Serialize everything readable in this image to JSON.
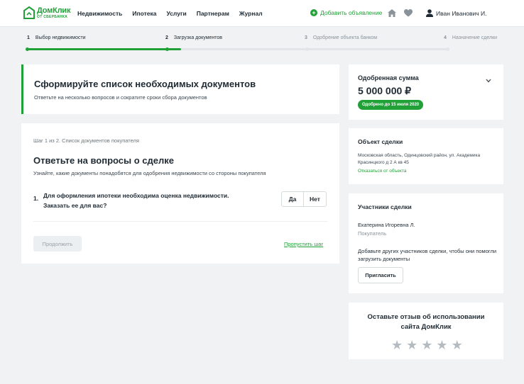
{
  "header": {
    "logo_main": "ДомКлик",
    "logo_sub": "ОТ СБЕРБАНКА",
    "nav": [
      "Недвижимость",
      "Ипотека",
      "Услуги",
      "Партнерам",
      "Журнал"
    ],
    "add_ad": "Добавить объявление",
    "user_name": "Иван Иванович И."
  },
  "steps": [
    {
      "num": "1",
      "label": "Выбор недвижимости"
    },
    {
      "num": "2",
      "label": "Загрузка документов"
    },
    {
      "num": "3",
      "label": "Одобрение объекта банком"
    },
    {
      "num": "4",
      "label": "Назначение сделки"
    }
  ],
  "progress": {
    "completed_steps": 2,
    "current_step_fraction": 0.1
  },
  "intro": {
    "title": "Сформируйте список необходимых документов",
    "subtitle": "Ответьте на несколько вопросов и сократите сроки сбора документов"
  },
  "questionnaire": {
    "step_label": "Шаг 1 из 2. Список документов покупателя",
    "title": "Ответьте на вопросы о сделке",
    "subtitle": "Узнайте, какие документы понадобятся для одобрения недвижимости со стороны покупателя",
    "question_num": "1.",
    "question_line1": "Для оформления ипотеки необходима оценка недвижимости.",
    "question_line2": "Заказать ее для вас?",
    "yes": "Да",
    "no": "Нет",
    "continue": "Продолжить",
    "skip": "Пропустить шаг"
  },
  "approved": {
    "title": "Одобренная сумма",
    "amount": "5 000 000 ₽",
    "badge": "Одобрено до 15 июля 2020"
  },
  "deal": {
    "title": "Объект сделки",
    "address": "Московская область, Одинцовский район, ул. Академика Красинцкого д 2 А кв 45",
    "remove": "Отказаться от объекта"
  },
  "participants": {
    "title": "Участники сделки",
    "name": "Екатерина Игоревна Л.",
    "role": "Покупатель",
    "invite_text": "Добавьте других участников сделки, чтобы они помогли загрузить документы",
    "invite_button": "Пригласить"
  },
  "review": {
    "title": "Оставьте отзыв об использовании сайта ДомКлик",
    "rating": 0,
    "max_rating": 5
  },
  "colors": {
    "accent": "#21a038",
    "background": "#f0f2f3",
    "text": "#1f2a33",
    "muted": "#8a9399"
  }
}
